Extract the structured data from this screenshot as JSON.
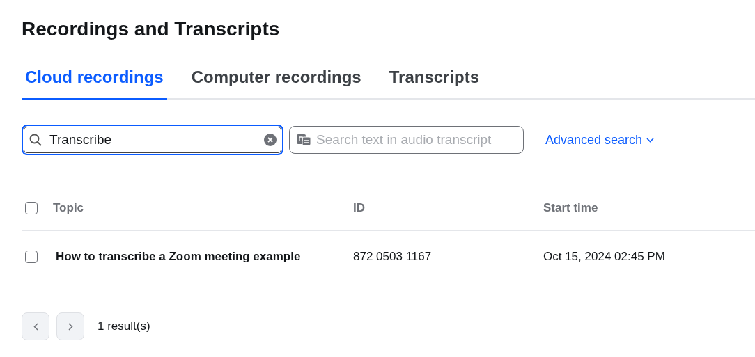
{
  "title": "Recordings and Transcripts",
  "tabs": [
    {
      "label": "Cloud recordings",
      "selected": true
    },
    {
      "label": "Computer recordings",
      "selected": false
    },
    {
      "label": "Transcripts",
      "selected": false
    }
  ],
  "search": {
    "value": "Transcribe"
  },
  "transcript_search": {
    "placeholder": "Search text in audio transcript"
  },
  "advanced_search": "Advanced search",
  "table": {
    "columns": [
      "Topic",
      "ID",
      "Start time"
    ],
    "header_checked": false,
    "rows": [
      {
        "checked": false,
        "cells": [
          "How to transcribe a Zoom meeting example",
          "872 0503 1167",
          "Oct 15, 2024 02:45 PM"
        ]
      }
    ]
  },
  "result_count": "1 result(s)"
}
